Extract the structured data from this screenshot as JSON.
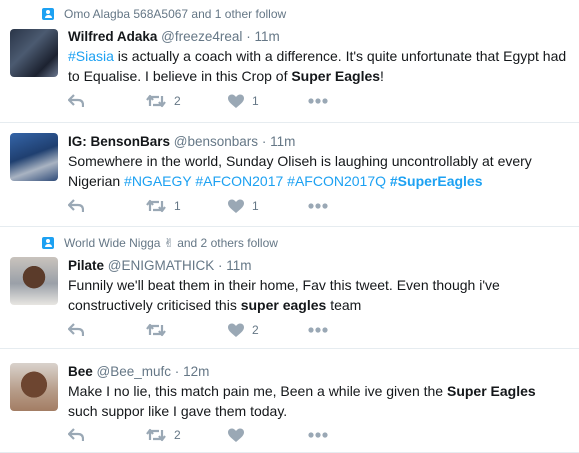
{
  "tweets": [
    {
      "social": "Omo Alagba 568A5067 and 1 other follow",
      "name": "Wilfred Adaka",
      "handle": "@freeze4real",
      "time": "11m",
      "segments": [
        {
          "t": "#Siasia",
          "s": "hl"
        },
        {
          "t": " is actually a coach with a difference. It's quite unfortunate that Egypt had to Equalise. I believe in this Crop of ",
          "s": ""
        },
        {
          "t": "Super Eagles",
          "s": "b"
        },
        {
          "t": "!",
          "s": ""
        }
      ],
      "retweets": "2",
      "likes": "1"
    },
    {
      "social": "",
      "name": "IG: BensonBars",
      "handle": "@bensonbars",
      "time": "11m",
      "segments": [
        {
          "t": "Somewhere in the world, Sunday Oliseh is laughing uncontrollably at every Nigerian ",
          "s": ""
        },
        {
          "t": "#NGAEGY #AFCON2017 #AFCON2017Q ",
          "s": "hl"
        },
        {
          "t": "#SuperEagles",
          "s": "hl b"
        }
      ],
      "retweets": "1",
      "likes": "1"
    },
    {
      "social": "World Wide Nigga ✌ and 2 others follow",
      "name": "Pilate",
      "handle": "@ENIGMATHICK",
      "time": "11m",
      "segments": [
        {
          "t": "Funnily we'll beat them in their home, Fav this tweet. Even though i've constructively criticised  this ",
          "s": ""
        },
        {
          "t": "super eagles",
          "s": "b"
        },
        {
          "t": " team",
          "s": ""
        }
      ],
      "retweets": "",
      "likes": "2"
    },
    {
      "social": "",
      "name": "Bee",
      "handle": "@Bee_mufc",
      "time": "12m",
      "segments": [
        {
          "t": "Make I no lie, this match pain me, Been a while ive given the ",
          "s": ""
        },
        {
          "t": "Super Eagles",
          "s": "b"
        },
        {
          "t": " such suppor like I gave them today.",
          "s": ""
        }
      ],
      "retweets": "2",
      "likes": ""
    }
  ],
  "header_separator": "·",
  "icons": {
    "reply": "reply-icon",
    "retweet": "retweet-icon",
    "like": "heart-icon",
    "more": "more-dots-icon",
    "social": "person-follow-icon"
  },
  "colors": {
    "link": "#1da1f2",
    "secondary_text": "#657786",
    "action_icon": "#9aa8b5",
    "divider": "#e6ecf0"
  }
}
